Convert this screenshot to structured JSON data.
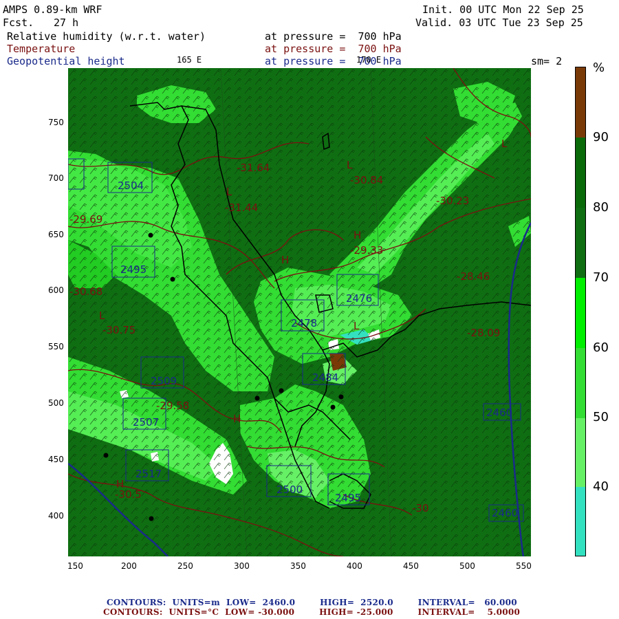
{
  "header": {
    "model": "AMPS 0.89-km WRF",
    "fcst_label": "Fcst.",
    "fcst_value": "27 h",
    "init": "Init. 00 UTC Mon 22 Sep 25",
    "valid": "Valid. 03 UTC Tue 23 Sep 25",
    "field1": "Relative humidity (w.r.t. water)",
    "field2": "Temperature",
    "field3": "Geopotential height",
    "level1": "at pressure =  700 hPa",
    "level2": "at pressure =  700 hPa",
    "level3": "at pressure =  700 hPa",
    "lon165": "165 E",
    "lon170": "170 E",
    "smoothing": "sm= 2"
  },
  "colorbar": {
    "unit": "%",
    "labels": [
      "90",
      "80",
      "70",
      "60",
      "50",
      "40"
    ],
    "levels": [
      {
        "range": "30-40",
        "color": "#33e0c0"
      },
      {
        "range": "40-50",
        "color": "#66f066"
      },
      {
        "range": "50-60",
        "color": "#33dd33"
      },
      {
        "range": "60-70",
        "color": "#00ee00"
      },
      {
        "range": "70-80",
        "color": "#0f6e12"
      },
      {
        "range": "80-90",
        "color": "#0a6a0a"
      },
      {
        "range": "90-100",
        "color": "#7a3a08"
      }
    ]
  },
  "axes": {
    "x_ticks": [
      "150",
      "200",
      "250",
      "300",
      "350",
      "400",
      "450",
      "500",
      "550"
    ],
    "y_ticks": [
      "750",
      "700",
      "650",
      "600",
      "550",
      "500",
      "450",
      "400"
    ]
  },
  "map": {
    "height_labels": [
      "2504",
      "2495",
      "2476",
      "2478",
      "2484",
      "2509",
      "2507",
      "2517",
      "2500",
      "2460",
      "2460",
      "2495"
    ],
    "temp_labels": [
      "-30.68",
      "-30.75",
      "-29.69",
      "-31.64",
      "-31.44",
      "-30.84",
      "-30.23",
      "-29.33",
      "-29.58",
      "-28.09",
      "-28.46",
      "-30.5",
      "-30"
    ],
    "lowhigh_labels": [
      "L",
      "L",
      "L",
      "H",
      "H",
      "H",
      "L",
      "H",
      "L"
    ]
  },
  "footer": {
    "line1": "CONTOURS:  UNITS=m  LOW=  2460.0        HIGH=  2520.0        INTERVAL=   60.000",
    "line2": "CONTOURS:  UNITS=°C  LOW= -30.000        HIGH= -25.000        INTERVAL=    5.0000"
  }
}
